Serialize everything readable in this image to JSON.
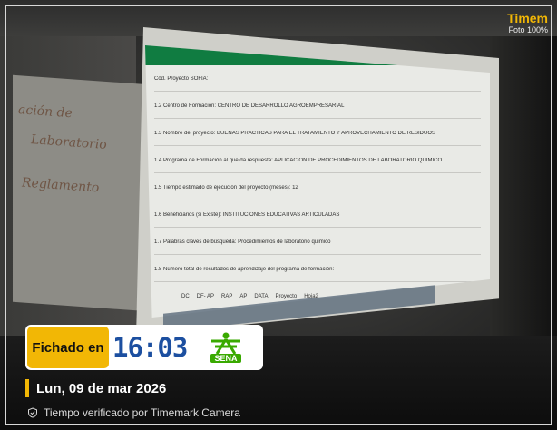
{
  "watermark": {
    "brand": "Timem",
    "sub": "Foto 100%"
  },
  "projected_sheet": {
    "rows": [
      "Cód. Proyecto SOFIA:",
      "1.2 Centro de Formación:      CENTRO DE DESARROLLO AGROEMPRESARIAL",
      "1.3 Nombre del proyecto:   BUENAS PRÁCTICAS PARA EL TRATAMIENTO Y APROVECHAMIENTO DE RESIDUOS",
      "1.4 Programa de Formación al que da respuesta:   APLICACIÓN DE PROCEDIMIENTOS DE LABORATORIO QUÍMICO",
      "1.5 Tiempo estimado de ejecución del proyecto (meses):   12",
      "1.6 Beneficiarios (si Existe):   INSTITUCIONES EDUCATIVAS ARTICULADAS",
      "1.7 Palabras claves de búsqueda:   Procedimientos de laboratorio químico",
      "1.8 Número total de resultados de aprendizaje del programa de formación:"
    ],
    "sheet_tabs": [
      "DC",
      "DF- AP",
      "RAP",
      "AP",
      "DATA",
      "Proyecto",
      "Hoja2"
    ]
  },
  "overlay": {
    "fichado_label": "Fichado en",
    "time": "16:03",
    "logo_text": "SENA",
    "date": "Lun, 09 de mar 2026",
    "verified": "Tiempo verificado por Timemark Camera"
  },
  "colors": {
    "accent_yellow": "#f2b705",
    "time_blue": "#1c4fa0",
    "sena_green": "#39a900",
    "excel_green": "#107c41"
  }
}
